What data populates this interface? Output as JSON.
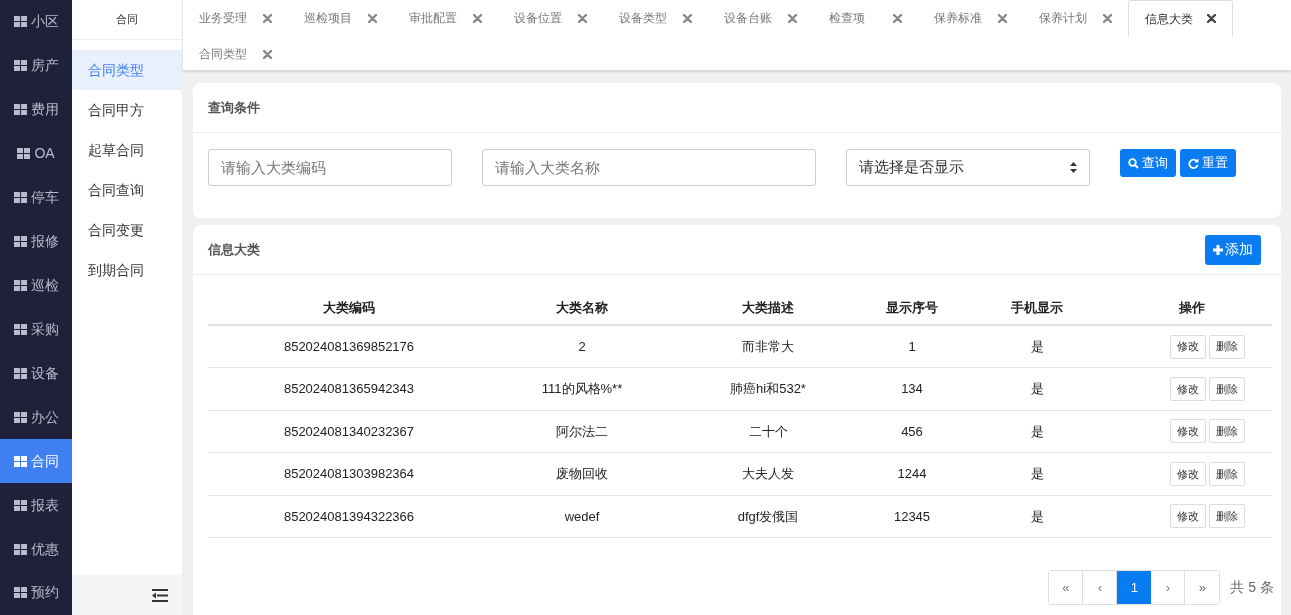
{
  "nav": [
    {
      "label": "小区",
      "selected": false
    },
    {
      "label": "房产",
      "selected": false
    },
    {
      "label": "费用",
      "selected": false
    },
    {
      "label": "OA",
      "selected": false
    },
    {
      "label": "停车",
      "selected": false
    },
    {
      "label": "报修",
      "selected": false
    },
    {
      "label": "巡检",
      "selected": false
    },
    {
      "label": "采购",
      "selected": false
    },
    {
      "label": "设备",
      "selected": false
    },
    {
      "label": "办公",
      "selected": false
    },
    {
      "label": "合同",
      "selected": true
    },
    {
      "label": "报表",
      "selected": false
    },
    {
      "label": "优惠",
      "selected": false
    },
    {
      "label": "预约",
      "selected": false
    }
  ],
  "submenu": {
    "title": "合同",
    "items": [
      {
        "label": "合同类型",
        "selected": true
      },
      {
        "label": "合同甲方",
        "selected": false
      },
      {
        "label": "起草合同",
        "selected": false
      },
      {
        "label": "合同查询",
        "selected": false
      },
      {
        "label": "合同变更",
        "selected": false
      },
      {
        "label": "到期合同",
        "selected": false
      }
    ]
  },
  "tabs": [
    {
      "label": "业务受理",
      "selected": false
    },
    {
      "label": "巡检项目",
      "selected": false
    },
    {
      "label": "审批配置",
      "selected": false
    },
    {
      "label": "设备位置",
      "selected": false
    },
    {
      "label": "设备类型",
      "selected": false
    },
    {
      "label": "设备台账",
      "selected": false
    },
    {
      "label": "检查项",
      "selected": false
    },
    {
      "label": "保养标准",
      "selected": false
    },
    {
      "label": "保养计划",
      "selected": false
    },
    {
      "label": "信息大类",
      "selected": true
    },
    {
      "label": "合同类型",
      "selected": false
    }
  ],
  "query": {
    "title": "查询条件",
    "fields": [
      {
        "placeholder": "请输入大类编码"
      },
      {
        "placeholder": "请输入大类名称"
      }
    ],
    "select": "请选择是否显示",
    "buttons": [
      {
        "kind": "search",
        "label": "查询"
      },
      {
        "kind": "reset",
        "label": "重置"
      }
    ]
  },
  "table": {
    "title": "信息大类",
    "add_button": "添加",
    "columns": [
      "大类编码",
      "大类名称",
      "大类描述",
      "显示序号",
      "手机显示",
      "操作"
    ],
    "rows": [
      {
        "cells": [
          "852024081369852176",
          "2",
          "而非常大",
          "1",
          "是"
        ],
        "actions": [
          "修改",
          "删除"
        ]
      },
      {
        "cells": [
          "852024081365942343",
          "111的风格%**",
          "肺癌hi和532*",
          "134",
          "是"
        ],
        "actions": [
          "修改",
          "删除"
        ]
      },
      {
        "cells": [
          "852024081340232367",
          "阿尔法二",
          "二十个",
          "456",
          "是"
        ],
        "actions": [
          "修改",
          "删除"
        ]
      },
      {
        "cells": [
          "852024081303982364",
          "废物回收",
          "大夫人发",
          "1244",
          "是"
        ],
        "actions": [
          "修改",
          "删除"
        ]
      },
      {
        "cells": [
          "852024081394322366",
          "wedef",
          "dfgf发俄国",
          "12345",
          "是"
        ],
        "actions": [
          "修改",
          "删除"
        ]
      }
    ]
  },
  "pagination": {
    "pages": [
      {
        "label": "«",
        "selected": false
      },
      {
        "label": "‹",
        "selected": false
      },
      {
        "label": "1",
        "selected": true
      },
      {
        "label": "›",
        "selected": false
      },
      {
        "label": "»",
        "selected": false
      }
    ],
    "total": "共 5 条"
  }
}
